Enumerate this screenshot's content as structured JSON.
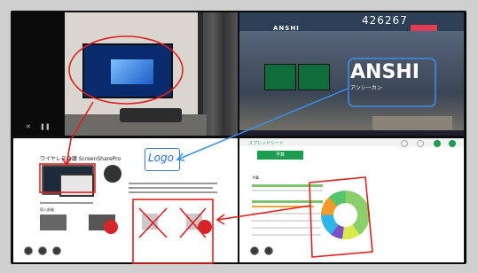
{
  "top_right": {
    "code": "426267",
    "logo_small": "ANSHI",
    "hero_title": "ANSHI",
    "hero_sub": "アンシーカン"
  },
  "bottom_left": {
    "doc_title": "ワイヤレス会議 ScreenSharePro",
    "section_label": "導入前後",
    "handwritten_label": "Logo"
  },
  "bottom_right": {
    "app_title": "スプレッドシート",
    "tab_label": "予算",
    "row_label": "予算"
  },
  "annotations": {
    "ink_color": "#e02020",
    "blue_ink": "#3a8ee6"
  }
}
